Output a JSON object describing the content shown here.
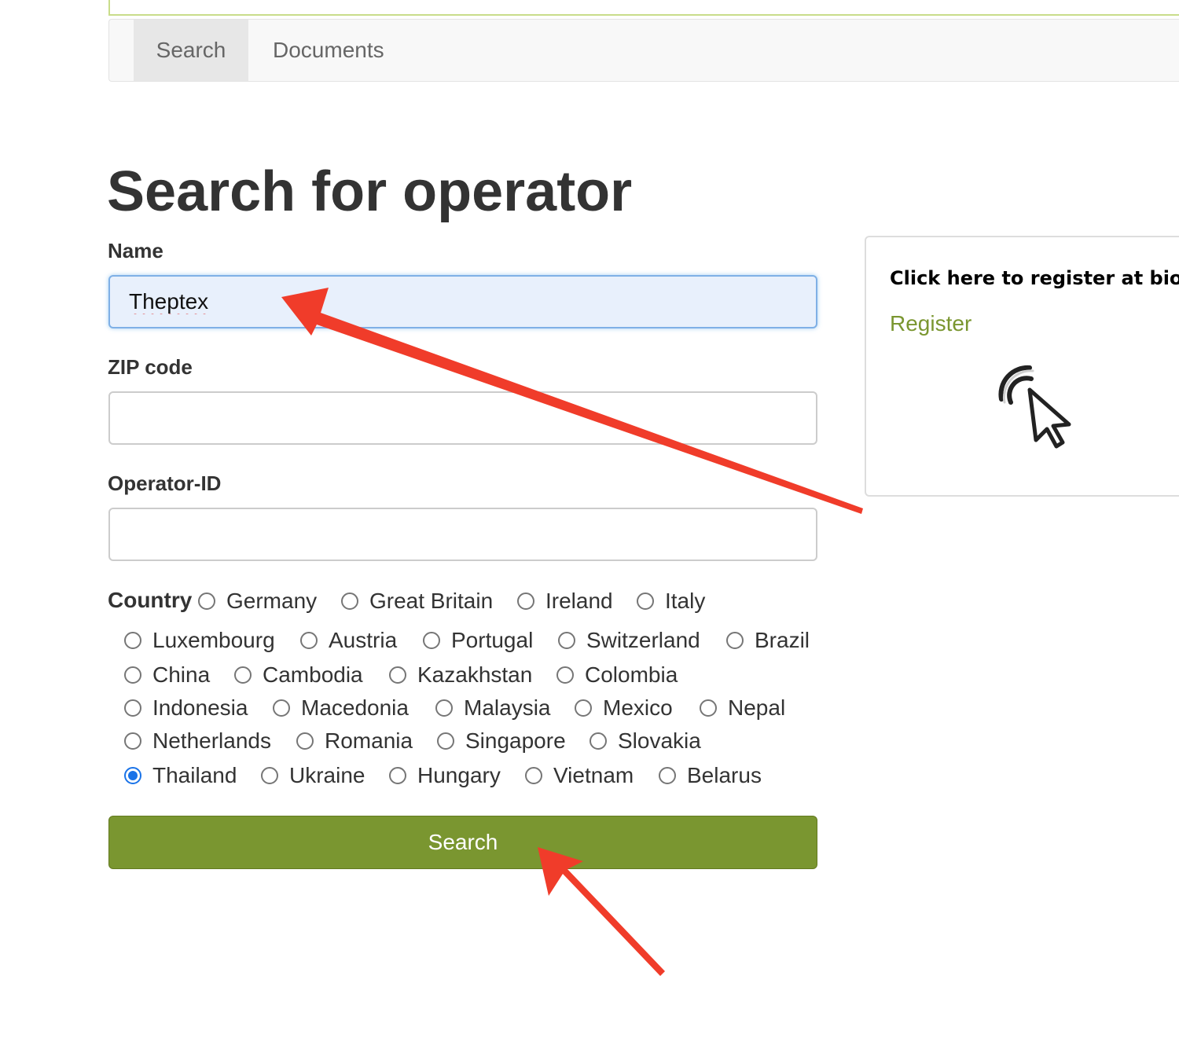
{
  "nav": {
    "tabs": [
      {
        "label": "Search"
      },
      {
        "label": "Documents"
      }
    ]
  },
  "page": {
    "title": "Search for operator"
  },
  "form": {
    "name": {
      "label": "Name",
      "value": "Theptex"
    },
    "zip": {
      "label": "ZIP code",
      "value": ""
    },
    "operator_id": {
      "label": "Operator-ID",
      "value": ""
    },
    "country": {
      "label": "Country",
      "selected": "Thailand",
      "options": [
        "Germany",
        "Great Britain",
        "Ireland",
        "Italy",
        "Luxembourg",
        "Austria",
        "Portugal",
        "Switzerland",
        "Brazil",
        "China",
        "Cambodia",
        "Kazakhstan",
        "Colombia",
        "Indonesia",
        "Macedonia",
        "Malaysia",
        "Mexico",
        "Nepal",
        "Netherlands",
        "Romania",
        "Singapore",
        "Slovakia",
        "Thailand",
        "Ukraine",
        "Hungary",
        "Vietnam",
        "Belarus"
      ]
    },
    "submit_label": "Search"
  },
  "register": {
    "heading": "Click here to register at bio",
    "link_label": "Register",
    "icon": "click-cursor-icon"
  },
  "colors": {
    "accent_green": "#7a9630",
    "annotation_red": "#f03c2a",
    "radio_selected": "#1a73e8"
  }
}
